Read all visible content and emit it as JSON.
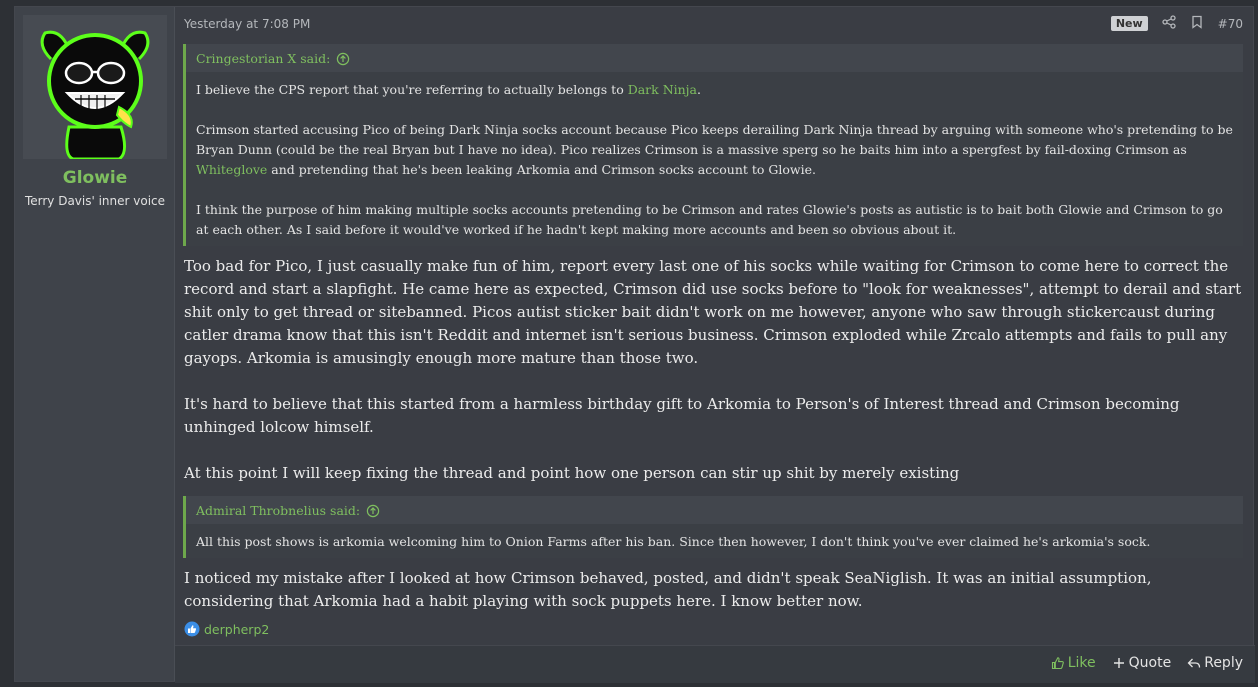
{
  "user": {
    "name": "Glowie",
    "title": "Terry Davis' inner voice"
  },
  "meta": {
    "timestamp": "Yesterday at 7:08 PM",
    "badge": "New",
    "post_number": "#70"
  },
  "quote1": {
    "author": "Cringestorian X said:",
    "paragraphs": [
      {
        "parts": [
          "I believe the CPS report that you're referring to actually belongs to ",
          "Dark Ninja",
          "."
        ]
      },
      {
        "parts": [
          "Crimson started accusing Pico of being Dark Ninja socks account because Pico keeps derailing Dark Ninja thread by arguing with someone who's pretending to be Bryan Dunn (could be the real Bryan but I have no idea). Pico realizes Crimson is a massive sperg so he baits him into a spergfest by fail-doxing Crimson as ",
          "Whiteglove",
          " and pretending that he's been leaking Arkomia and Crimson socks account to Glowie."
        ]
      },
      {
        "parts": [
          "I think the purpose of him making multiple socks accounts pretending to be Crimson and rates Glowie's posts as autistic is to bait both Glowie and Crimson to go at each other. As I said before it would've worked if he hadn't kept making more accounts and been so obvious about it."
        ]
      }
    ]
  },
  "body1": [
    "Too bad for Pico, I just casually make fun of him, report every last one of his socks while waiting for Crimson to come here to correct the record and start a slapfight. He came here as expected, Crimson did use socks before to \"look for weaknesses\", attempt to derail and start shit only to get thread or sitebanned. Picos autist sticker bait didn't work on me however, anyone who saw through stickercaust during catler drama know that this isn't Reddit and internet isn't serious business. Crimson exploded while Zrcalo attempts and fails to pull any gayops. Arkomia is amusingly enough more mature than those two.",
    "It's hard to believe that this started from a harmless birthday gift to Arkomia to Person's of Interest thread and Crimson becoming unhinged lolcow himself.",
    "At this point I will keep fixing the thread and point how one person can stir up shit by merely existing"
  ],
  "quote2": {
    "author": "Admiral Throbnelius said:",
    "text": "All this post shows is arkomia welcoming him to Onion Farms after his ban. Since then however, I don't think you've ever claimed he's arkomia's sock."
  },
  "body2": "I noticed my mistake after I looked at how Crimson behaved, posted, and didn't speak SeaNiglish. It was an initial assumption, considering that Arkomia had a habit playing with sock puppets here. I know better now.",
  "reaction": {
    "user": "derpherp2",
    "icon": "like-reaction-icon"
  },
  "actions": {
    "like": "Like",
    "quote": "Quote",
    "reply": "Reply"
  },
  "colors": {
    "accent": "#7fbf5f",
    "avatar_glow": "#5cff1a"
  }
}
